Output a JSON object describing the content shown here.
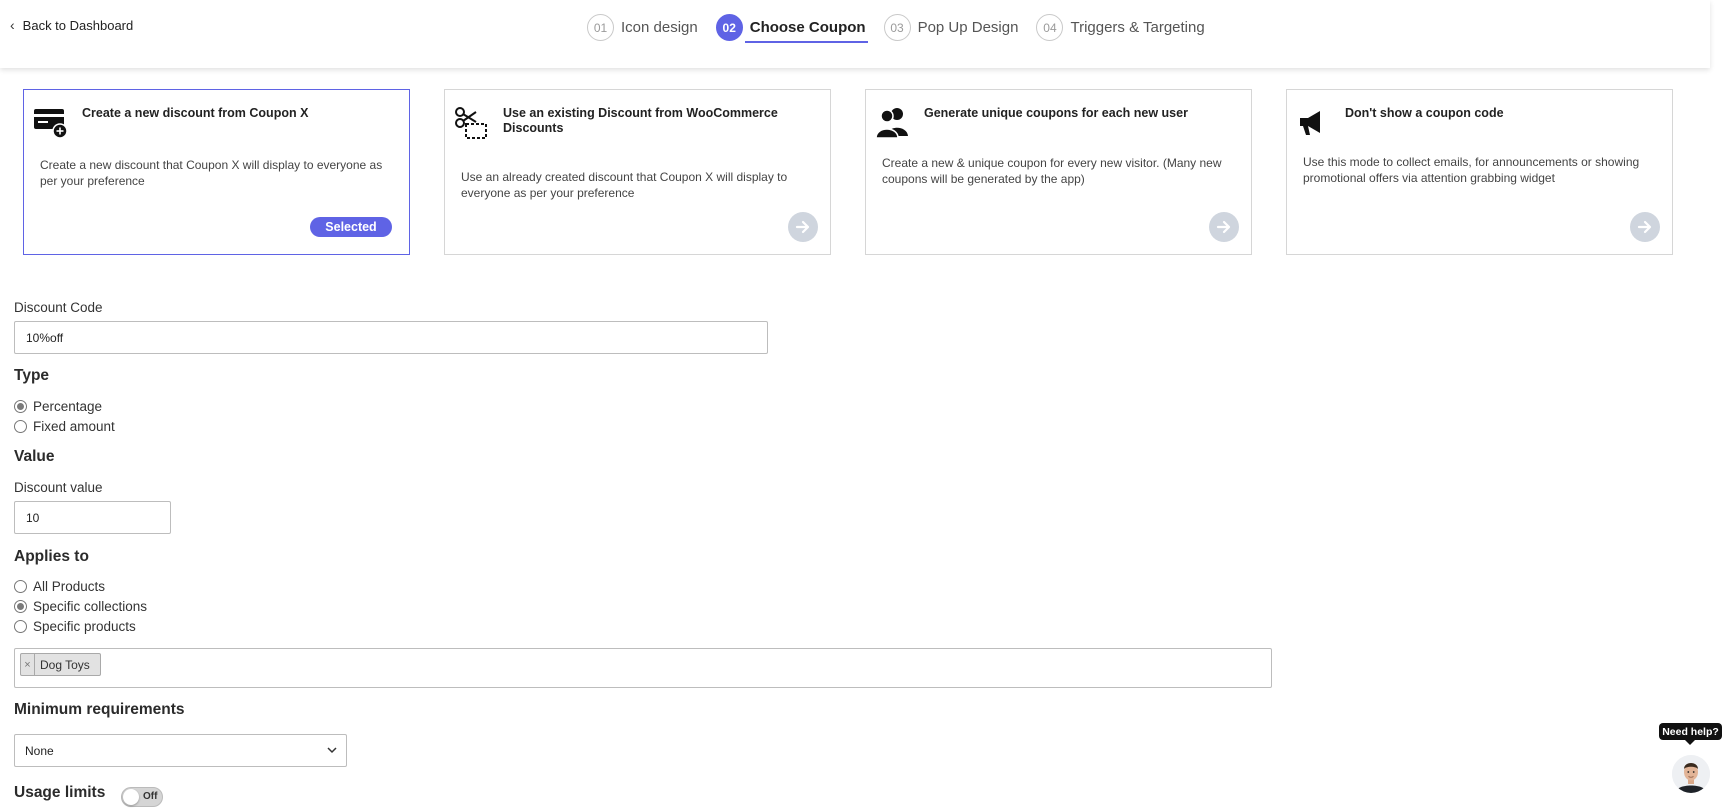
{
  "header": {
    "back_label": "Back to Dashboard",
    "steps": [
      {
        "num": "01",
        "label": "Icon design"
      },
      {
        "num": "02",
        "label": "Choose Coupon"
      },
      {
        "num": "03",
        "label": "Pop Up Design"
      },
      {
        "num": "04",
        "label": "Triggers & Targeting"
      }
    ],
    "active_step": 1
  },
  "cards": [
    {
      "icon": "credit-card-plus-icon",
      "title": "Create a new discount from Coupon X",
      "desc": "Create a new discount that Coupon X will display to everyone as per your preference",
      "selected": true,
      "badge": "Selected"
    },
    {
      "icon": "scissors-coupon-icon",
      "title": "Use an existing Discount from WooCommerce Discounts",
      "desc": "Use an already created discount that Coupon X will display to everyone as per your preference",
      "selected": false
    },
    {
      "icon": "users-icon",
      "title": "Generate unique coupons for each new user",
      "desc": "Create a new & unique coupon for every new visitor. (Many new coupons will be generated by the app)",
      "selected": false
    },
    {
      "icon": "megaphone-icon",
      "title": "Don't show a coupon code",
      "desc": "Use this mode to collect emails, for announcements or showing promotional offers via attention grabbing widget",
      "selected": false
    }
  ],
  "form": {
    "discount_code_label": "Discount Code",
    "discount_code_value": "10%off",
    "type_heading": "Type",
    "type_options": [
      {
        "label": "Percentage",
        "checked": true
      },
      {
        "label": "Fixed amount",
        "checked": false
      }
    ],
    "value_heading": "Value",
    "discount_value_label": "Discount value",
    "discount_value": "10",
    "applies_heading": "Applies to",
    "applies_options": [
      {
        "label": "All Products",
        "checked": false
      },
      {
        "label": "Specific collections",
        "checked": true
      },
      {
        "label": "Specific products",
        "checked": false
      }
    ],
    "tags": [
      "Dog Toys"
    ],
    "tag_remove": "×",
    "min_heading": "Minimum requirements",
    "min_selected": "None",
    "usage_heading": "Usage limits",
    "usage_toggle": "Off"
  },
  "help": {
    "label": "Need help?"
  },
  "colors": {
    "accent": "#5f63e5",
    "arrow_bg": "#cfd5de"
  }
}
